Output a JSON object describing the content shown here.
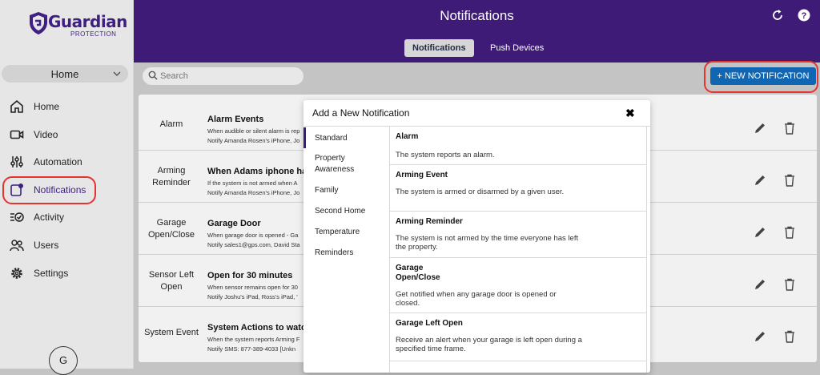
{
  "brand": {
    "name": "Guardian",
    "sub": "PROTECTION",
    "color": "#3f1f7f",
    "accent": "#1166b3",
    "highlight": "#e3342f"
  },
  "sidebar": {
    "location": "Home",
    "items": [
      {
        "label": "Home",
        "icon": "home-icon"
      },
      {
        "label": "Video",
        "icon": "video-camera-icon"
      },
      {
        "label": "Automation",
        "icon": "sliders-icon"
      },
      {
        "label": "Notifications",
        "icon": "notification-icon",
        "active": true
      },
      {
        "label": "Activity",
        "icon": "activity-list-icon"
      },
      {
        "label": "Users",
        "icon": "users-icon"
      },
      {
        "label": "Settings",
        "icon": "gear-icon"
      }
    ],
    "avatar": "G"
  },
  "header": {
    "title": "Notifications",
    "tabs": [
      "Notifications",
      "Push Devices"
    ],
    "icons": [
      "refresh-icon",
      "help-icon"
    ]
  },
  "toolbar": {
    "search_placeholder": "Search",
    "new_button": "+ NEW NOTIFICATION"
  },
  "list": [
    {
      "type": "Alarm",
      "title": "Alarm Events",
      "desc": "When audible or silent alarm is rep",
      "notify": "Notify Amanda Rosen's iPhone, Jo"
    },
    {
      "type": "Arming Reminder",
      "title": "When Adams iphone has",
      "desc": "If the system is not armed when A",
      "notify": "Notify Amanda Rosen's iPhone, Jo"
    },
    {
      "type": "Garage Open/Close",
      "title": "Garage Door",
      "desc": "When garage door is opened - Ga",
      "notify": "Notify sales1@gps.com, David Sta"
    },
    {
      "type": "Sensor Left Open",
      "title": "Open for 30 minutes",
      "desc": "When sensor remains open for 30",
      "notify": "Notify Joshu's iPad, Ross's iPad, '"
    },
    {
      "type": "System Event",
      "title": "System Actions to watch",
      "desc": "When the system reports Arming F",
      "notify": "Notify SMS: 877-389-4033 [Unkn"
    }
  ],
  "modal": {
    "title": "Add a New Notification",
    "close": "✖",
    "categories": [
      "Standard",
      "Property Awareness",
      "Family",
      "Second Home",
      "Temperature",
      "Reminders"
    ],
    "options": [
      {
        "title": "Alarm",
        "desc": "The system reports an alarm."
      },
      {
        "title": "Arming Event",
        "desc": "The system is armed or disarmed by a given user."
      },
      {
        "title": "Arming Reminder",
        "desc": "The system is not armed by the time everyone has left the property."
      },
      {
        "title": "Garage Open/Close",
        "desc": "Get notified when any garage door is opened or closed."
      },
      {
        "title": "Garage Left Open",
        "desc": "Receive an alert when your garage is left open during a specified time frame."
      }
    ]
  }
}
